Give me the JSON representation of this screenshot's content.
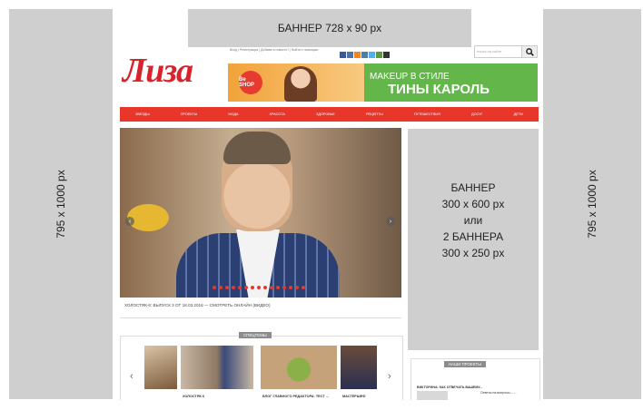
{
  "layout_labels": {
    "top_banner": "БАННЕР 728 х 90 px",
    "left_side": "795 х 1000 px",
    "right_side": "795 х 1000 px",
    "right_banner_lines": [
      "БАННЕР",
      "300 х 600 px",
      "или",
      "2 БАННЕРА",
      "300 х 250 px"
    ]
  },
  "site": {
    "logo": "Лиза",
    "top_links": "Вход | Регистрация | Добавить новость? | Войти с помощью:",
    "search_placeholder": "поиск на сайте"
  },
  "promo": {
    "badge": "Be SHOP",
    "line1": "MAKEUP В СТИЛЕ",
    "line2": "ТИНЫ КАРОЛЬ",
    "brand_colors": {
      "green": "#63b649",
      "orange": "#f2a33a"
    }
  },
  "nav": {
    "items": [
      "ЗВЕЗДЫ",
      "ПРОЕКТЫ",
      "МОДА",
      "КРАСОТА",
      "ЗДОРОВЬЕ",
      "РЕЦЕПТЫ",
      "ПУТЕШЕСТВИЯ",
      "ДОСУГ",
      "ДЕТИ"
    ]
  },
  "hero": {
    "caption": "ХОЛОСТЯК-6: ВЫПУСК 3 ОТ 18.03.2016 — СМОТРЕТЬ ОНЛАЙН (ВИДЕО)"
  },
  "special": {
    "title": "СПЕЦТЕМЫ",
    "items": [
      "ХОЛОСТЯК 6",
      "БЛОГ ГЛАВНОГО РЕДАКТОРА: ТЕСТ ...",
      "МАСТЕРШЕФ"
    ]
  },
  "projects": {
    "title": "НАШИ ПРОЕКТЫ",
    "text1": "ВИКТОРИНА: КАК ОТВЕЧАТЬ ВАШЕМУ...",
    "text2": "Ответы на вопросы – ..."
  },
  "colors": {
    "accent": "#e8372a",
    "logo": "#d8232a",
    "placeholder_gray": "#cfcfcf"
  },
  "icons": [
    "facebook-icon",
    "vk-icon",
    "odnoklassniki-icon",
    "instagram-icon",
    "twitter-icon",
    "google-icon",
    "youtube-icon",
    "search-icon",
    "chevron-left-icon",
    "chevron-right-icon"
  ]
}
